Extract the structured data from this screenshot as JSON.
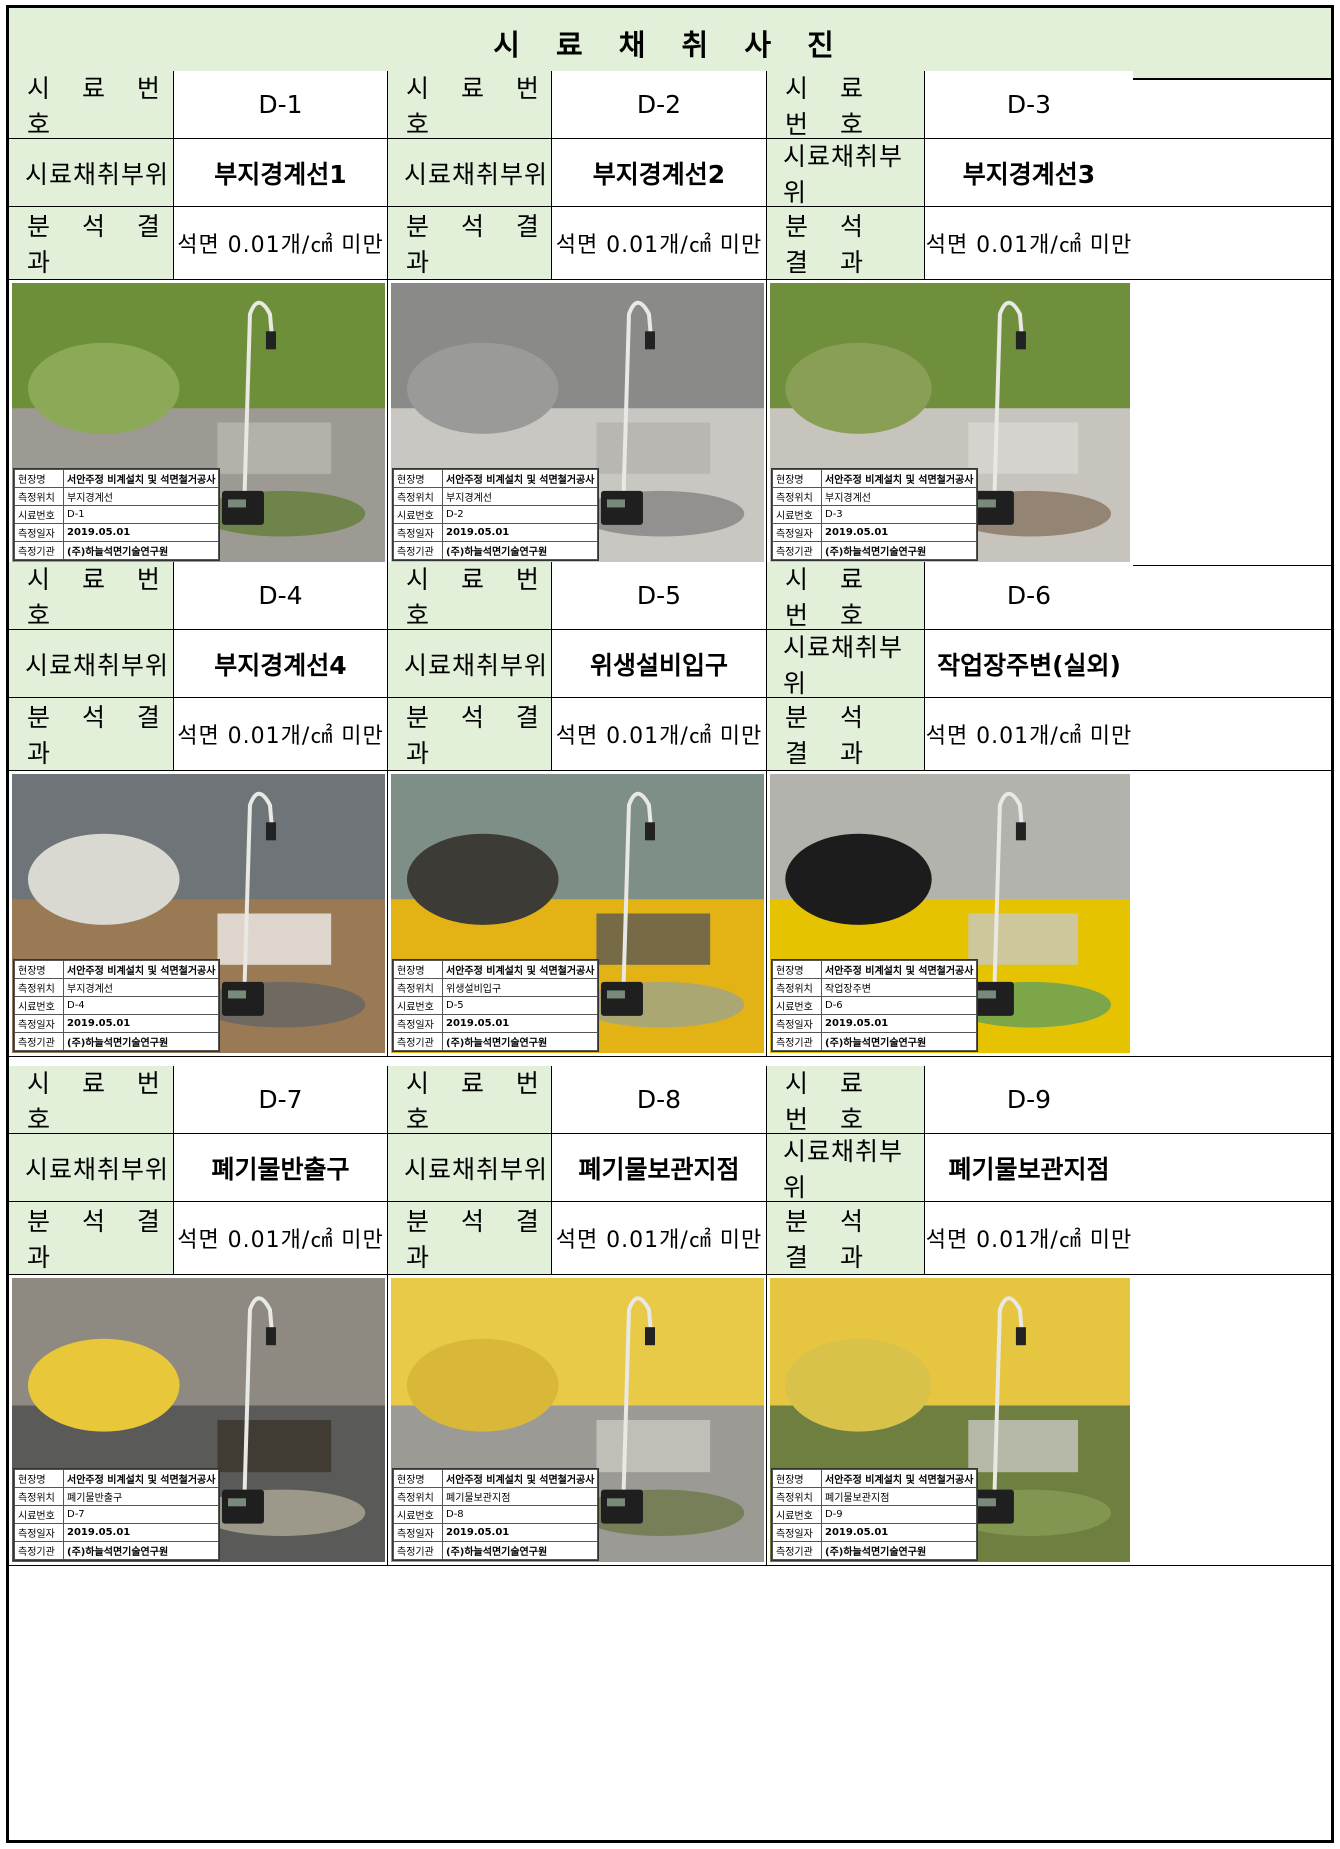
{
  "title": "시 료 채 취 사 진",
  "labels": {
    "sample_no": "시 료 번 호",
    "location": "시료채취부위",
    "result": "분 석 결 과"
  },
  "caption_keys": {
    "site": "현장명",
    "position": "측정위치",
    "number": "시료번호",
    "date": "측정일자",
    "agency": "측정기관"
  },
  "common": {
    "site": "서안주정 비계설치 및 석면철거공사",
    "date": "2019.05.01",
    "agency": "(주)하늘석면기술연구원",
    "result": "석면 0.01개/㎠ 미만"
  },
  "samples": [
    {
      "id": "D-1",
      "location": "부지경계선1",
      "cap_position": "부지경계선",
      "photo_scene": "grass-rocks"
    },
    {
      "id": "D-2",
      "location": "부지경계선2",
      "cap_position": "부지경계선",
      "photo_scene": "concrete-wall"
    },
    {
      "id": "D-3",
      "location": "부지경계선3",
      "cap_position": "부지경계선",
      "photo_scene": "grass-gravel"
    },
    {
      "id": "D-4",
      "location": "부지경계선4",
      "cap_position": "부지경계선",
      "photo_scene": "metal-door-sacks"
    },
    {
      "id": "D-5",
      "location": "위생설비입구",
      "cap_position": "위생설비입구",
      "photo_scene": "tarp-sign"
    },
    {
      "id": "D-6",
      "location": "작업장주변(실외)",
      "cap_position": "작업장주변",
      "photo_scene": "bollard-fence"
    },
    {
      "id": "D-7",
      "location": "폐기물반출구",
      "cap_position": "폐기물반출구",
      "photo_scene": "yellow-tarp-debris"
    },
    {
      "id": "D-8",
      "location": "폐기물보관지점",
      "cap_position": "폐기물보관지점",
      "photo_scene": "yellow-bags-pallet"
    },
    {
      "id": "D-9",
      "location": "폐기물보관지점",
      "cap_position": "폐기물보관지점",
      "photo_scene": "yellow-bags-field"
    }
  ],
  "colors": {
    "header_fill": "#e2efd9",
    "border": "#000000"
  }
}
